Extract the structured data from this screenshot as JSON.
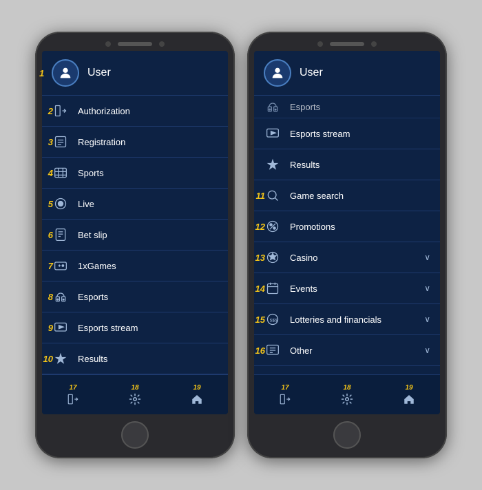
{
  "phone1": {
    "user": "User",
    "menu_items": [
      {
        "number": "1",
        "icon": "👤",
        "label": "User",
        "is_header": true
      },
      {
        "number": "2",
        "icon": "🔑",
        "label": "Authorization"
      },
      {
        "number": "3",
        "icon": "📋",
        "label": "Registration"
      },
      {
        "number": "4",
        "icon": "⚽",
        "label": "Sports"
      },
      {
        "number": "5",
        "icon": "🔴",
        "label": "Live"
      },
      {
        "number": "6",
        "icon": "🎫",
        "label": "Bet slip"
      },
      {
        "number": "7",
        "icon": "🎮",
        "label": "1xGames"
      },
      {
        "number": "8",
        "icon": "🕹️",
        "label": "Esports"
      },
      {
        "number": "9",
        "icon": "📺",
        "label": "Esports stream"
      },
      {
        "number": "10",
        "icon": "🏆",
        "label": "Results"
      }
    ],
    "bottom_nav": [
      {
        "number": "17",
        "icon": "📥"
      },
      {
        "number": "18",
        "icon": "⚙️"
      },
      {
        "number": "19",
        "icon": "🏠"
      }
    ]
  },
  "phone2": {
    "user": "User",
    "menu_items": [
      {
        "icon": "🕹️",
        "label": "Esports",
        "truncated": true
      },
      {
        "icon": "📺",
        "label": "Esports stream"
      },
      {
        "icon": "🏆",
        "label": "Results"
      },
      {
        "number": "11",
        "icon": "🔍",
        "label": "Game search"
      },
      {
        "number": "12",
        "icon": "🎁",
        "label": "Promotions"
      },
      {
        "number": "13",
        "icon": "🎰",
        "label": "Casino",
        "has_chevron": true
      },
      {
        "number": "14",
        "icon": "📅",
        "label": "Events",
        "has_chevron": true
      },
      {
        "number": "15",
        "icon": "💰",
        "label": "Lotteries and financials",
        "has_chevron": true
      },
      {
        "number": "16",
        "icon": "⋯",
        "label": "Other",
        "has_chevron": true
      }
    ],
    "bottom_nav": [
      {
        "number": "17",
        "icon": "📥"
      },
      {
        "number": "18",
        "icon": "⚙️"
      },
      {
        "number": "19",
        "icon": "🏠"
      }
    ]
  }
}
